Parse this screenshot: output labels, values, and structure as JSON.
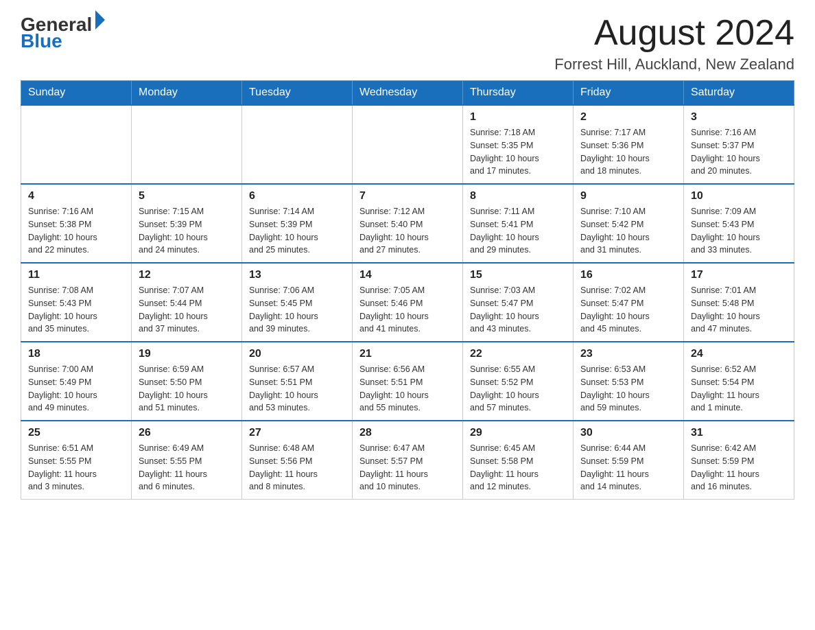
{
  "header": {
    "logo_general": "General",
    "logo_blue": "Blue",
    "month_title": "August 2024",
    "location": "Forrest Hill, Auckland, New Zealand"
  },
  "days_of_week": [
    "Sunday",
    "Monday",
    "Tuesday",
    "Wednesday",
    "Thursday",
    "Friday",
    "Saturday"
  ],
  "weeks": [
    [
      {
        "day": "",
        "info": ""
      },
      {
        "day": "",
        "info": ""
      },
      {
        "day": "",
        "info": ""
      },
      {
        "day": "",
        "info": ""
      },
      {
        "day": "1",
        "info": "Sunrise: 7:18 AM\nSunset: 5:35 PM\nDaylight: 10 hours\nand 17 minutes."
      },
      {
        "day": "2",
        "info": "Sunrise: 7:17 AM\nSunset: 5:36 PM\nDaylight: 10 hours\nand 18 minutes."
      },
      {
        "day": "3",
        "info": "Sunrise: 7:16 AM\nSunset: 5:37 PM\nDaylight: 10 hours\nand 20 minutes."
      }
    ],
    [
      {
        "day": "4",
        "info": "Sunrise: 7:16 AM\nSunset: 5:38 PM\nDaylight: 10 hours\nand 22 minutes."
      },
      {
        "day": "5",
        "info": "Sunrise: 7:15 AM\nSunset: 5:39 PM\nDaylight: 10 hours\nand 24 minutes."
      },
      {
        "day": "6",
        "info": "Sunrise: 7:14 AM\nSunset: 5:39 PM\nDaylight: 10 hours\nand 25 minutes."
      },
      {
        "day": "7",
        "info": "Sunrise: 7:12 AM\nSunset: 5:40 PM\nDaylight: 10 hours\nand 27 minutes."
      },
      {
        "day": "8",
        "info": "Sunrise: 7:11 AM\nSunset: 5:41 PM\nDaylight: 10 hours\nand 29 minutes."
      },
      {
        "day": "9",
        "info": "Sunrise: 7:10 AM\nSunset: 5:42 PM\nDaylight: 10 hours\nand 31 minutes."
      },
      {
        "day": "10",
        "info": "Sunrise: 7:09 AM\nSunset: 5:43 PM\nDaylight: 10 hours\nand 33 minutes."
      }
    ],
    [
      {
        "day": "11",
        "info": "Sunrise: 7:08 AM\nSunset: 5:43 PM\nDaylight: 10 hours\nand 35 minutes."
      },
      {
        "day": "12",
        "info": "Sunrise: 7:07 AM\nSunset: 5:44 PM\nDaylight: 10 hours\nand 37 minutes."
      },
      {
        "day": "13",
        "info": "Sunrise: 7:06 AM\nSunset: 5:45 PM\nDaylight: 10 hours\nand 39 minutes."
      },
      {
        "day": "14",
        "info": "Sunrise: 7:05 AM\nSunset: 5:46 PM\nDaylight: 10 hours\nand 41 minutes."
      },
      {
        "day": "15",
        "info": "Sunrise: 7:03 AM\nSunset: 5:47 PM\nDaylight: 10 hours\nand 43 minutes."
      },
      {
        "day": "16",
        "info": "Sunrise: 7:02 AM\nSunset: 5:47 PM\nDaylight: 10 hours\nand 45 minutes."
      },
      {
        "day": "17",
        "info": "Sunrise: 7:01 AM\nSunset: 5:48 PM\nDaylight: 10 hours\nand 47 minutes."
      }
    ],
    [
      {
        "day": "18",
        "info": "Sunrise: 7:00 AM\nSunset: 5:49 PM\nDaylight: 10 hours\nand 49 minutes."
      },
      {
        "day": "19",
        "info": "Sunrise: 6:59 AM\nSunset: 5:50 PM\nDaylight: 10 hours\nand 51 minutes."
      },
      {
        "day": "20",
        "info": "Sunrise: 6:57 AM\nSunset: 5:51 PM\nDaylight: 10 hours\nand 53 minutes."
      },
      {
        "day": "21",
        "info": "Sunrise: 6:56 AM\nSunset: 5:51 PM\nDaylight: 10 hours\nand 55 minutes."
      },
      {
        "day": "22",
        "info": "Sunrise: 6:55 AM\nSunset: 5:52 PM\nDaylight: 10 hours\nand 57 minutes."
      },
      {
        "day": "23",
        "info": "Sunrise: 6:53 AM\nSunset: 5:53 PM\nDaylight: 10 hours\nand 59 minutes."
      },
      {
        "day": "24",
        "info": "Sunrise: 6:52 AM\nSunset: 5:54 PM\nDaylight: 11 hours\nand 1 minute."
      }
    ],
    [
      {
        "day": "25",
        "info": "Sunrise: 6:51 AM\nSunset: 5:55 PM\nDaylight: 11 hours\nand 3 minutes."
      },
      {
        "day": "26",
        "info": "Sunrise: 6:49 AM\nSunset: 5:55 PM\nDaylight: 11 hours\nand 6 minutes."
      },
      {
        "day": "27",
        "info": "Sunrise: 6:48 AM\nSunset: 5:56 PM\nDaylight: 11 hours\nand 8 minutes."
      },
      {
        "day": "28",
        "info": "Sunrise: 6:47 AM\nSunset: 5:57 PM\nDaylight: 11 hours\nand 10 minutes."
      },
      {
        "day": "29",
        "info": "Sunrise: 6:45 AM\nSunset: 5:58 PM\nDaylight: 11 hours\nand 12 minutes."
      },
      {
        "day": "30",
        "info": "Sunrise: 6:44 AM\nSunset: 5:59 PM\nDaylight: 11 hours\nand 14 minutes."
      },
      {
        "day": "31",
        "info": "Sunrise: 6:42 AM\nSunset: 5:59 PM\nDaylight: 11 hours\nand 16 minutes."
      }
    ]
  ]
}
